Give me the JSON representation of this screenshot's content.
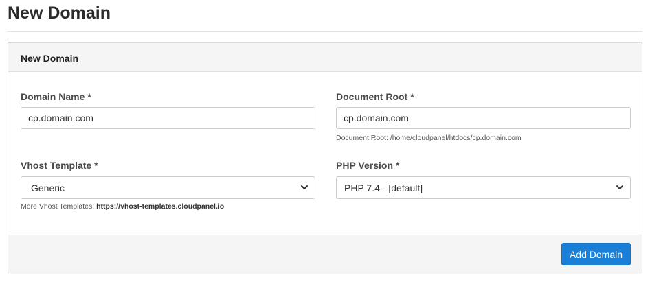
{
  "page": {
    "title": "New Domain"
  },
  "card": {
    "header_title": "New Domain"
  },
  "form": {
    "domain_name": {
      "label": "Domain Name *",
      "value": "cp.domain.com"
    },
    "document_root": {
      "label": "Document Root *",
      "value": "cp.domain.com",
      "help_prefix": "Document Root: ",
      "help_path": "/home/cloudpanel/htdocs/cp.domain.com"
    },
    "vhost_template": {
      "label": "Vhost Template *",
      "selected": "Generic",
      "help_prefix": "More Vhost Templates: ",
      "help_link": "https://vhost-templates.cloudpanel.io"
    },
    "php_version": {
      "label": "PHP Version *",
      "selected": "PHP 7.4 - [default]"
    }
  },
  "footer": {
    "submit_label": "Add Domain"
  },
  "colors": {
    "primary": "#1a7fd6",
    "header_bg": "#f5f5f5"
  },
  "icons": {
    "select_arrow": "chevron-down-icon"
  }
}
